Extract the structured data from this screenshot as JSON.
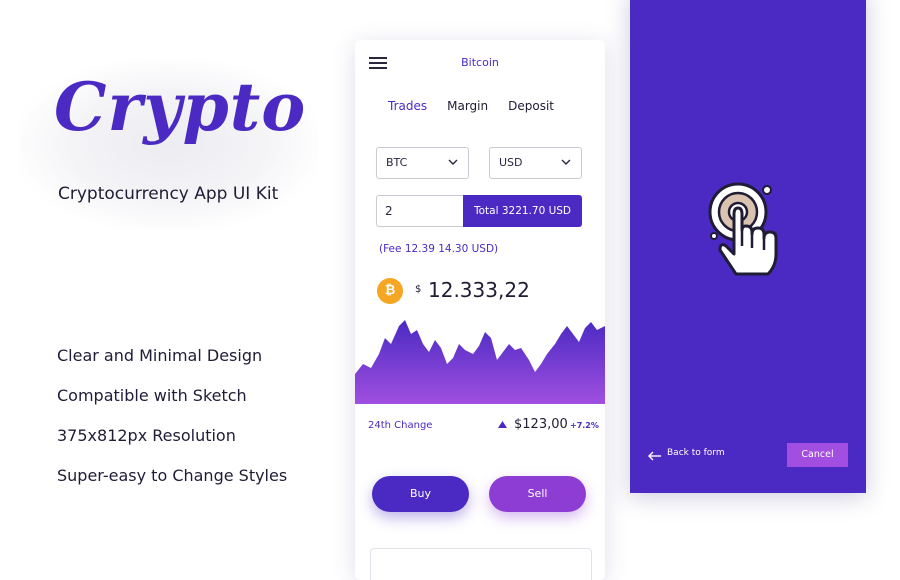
{
  "promo": {
    "title": "Crypto",
    "subtitle": "Cryptocurrency  App UI Kit",
    "features": [
      "Clear and Minimal Design",
      "Compatible with Sketch",
      "375x812px Resolution",
      "Super-easy to Change Styles"
    ]
  },
  "exchange_screen": {
    "title": "Bitcoin",
    "tabs": [
      {
        "label": "Trades",
        "active": true
      },
      {
        "label": "Margin",
        "active": false
      },
      {
        "label": "Deposit",
        "active": false
      }
    ],
    "from_currency": "BTC",
    "to_currency": "USD",
    "amount": "2",
    "total": "Total  3221.70 USD",
    "fee": "(Fee 12.39 14.30 USD)",
    "coin_symbol": "₿",
    "currency_sign": "$",
    "price": "12.333,22",
    "change_label": "24th Change",
    "change_value": "$123,00",
    "change_percent": "+7.2%",
    "buy_label": "Buy",
    "sell_label": "Sell",
    "colors": {
      "accent": "#4a2ac2",
      "secondary": "#8e3dd4",
      "coin": "#f5a623"
    }
  },
  "touch_screen": {
    "icon": "fingerprint-touch-icon",
    "back_label": "Back to form",
    "cancel_label": "Cancel",
    "background": "#4a2ac2"
  }
}
